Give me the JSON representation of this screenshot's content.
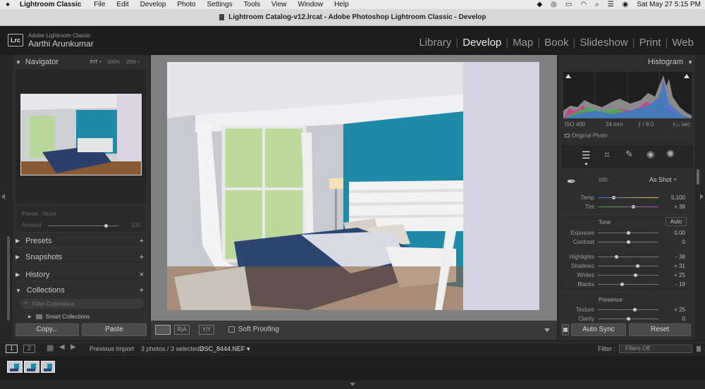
{
  "menubar": {
    "app": "Lightroom Classic",
    "items": [
      "File",
      "Edit",
      "Develop",
      "Photo",
      "Settings",
      "Tools",
      "View",
      "Window",
      "Help"
    ],
    "datetime": "Sat May 27  5:15 PM"
  },
  "window": {
    "title": "Lightroom Catalog-v12.lrcat - Adobe Photoshop Lightroom Classic - Develop"
  },
  "identity": {
    "logo": "Lrc",
    "product": "Adobe Lightroom Classic",
    "user": "Aarthi Arunkumar"
  },
  "modules": [
    "Library",
    "Develop",
    "Map",
    "Book",
    "Slideshow",
    "Print",
    "Web"
  ],
  "active_module": "Develop",
  "left": {
    "navigator": {
      "title": "Navigator",
      "zoom_fit": "FIT ÷",
      "zoom_100": "100%",
      "zoom_25": "25% ÷"
    },
    "preset": {
      "label": "Preset : None",
      "amount_label": "Amount",
      "amount_value": "100",
      "amount_fraction": 0.6
    },
    "sections": [
      {
        "name": "Presets",
        "action": "+"
      },
      {
        "name": "Snapshots",
        "action": "+"
      },
      {
        "name": "History",
        "action": "×"
      },
      {
        "name": "Collections",
        "action": "+"
      }
    ],
    "collections_filter_placeholder": "Filter Collections",
    "smart_collections": "Smart Collections",
    "copy_button": "Copy...",
    "paste_button": "Paste"
  },
  "toolbar": {
    "soft_proofing": "Soft Proofing",
    "compare_1": "R|A",
    "compare_2": "Y|Y"
  },
  "right": {
    "histogram": {
      "title": "Histogram",
      "iso": "ISO 400",
      "focal": "24 mm",
      "aperture": "ƒ / 8.0",
      "shutter": "¹⁄₂₅ sec",
      "original_photo": "Original Photo"
    },
    "wb": {
      "label": "WB :",
      "value": "As Shot ÷"
    },
    "sliders_wb": [
      {
        "label": "Temp",
        "value": "5,100",
        "pos": 0.25
      },
      {
        "label": "Tint",
        "value": "+ 38",
        "pos": 0.58
      }
    ],
    "tone": {
      "title": "Tone",
      "auto": "Auto"
    },
    "sliders_tone": [
      {
        "label": "Exposure",
        "value": "0.00",
        "pos": 0.5
      },
      {
        "label": "Contrast",
        "value": "0",
        "pos": 0.5
      }
    ],
    "sliders_tone2": [
      {
        "label": "Highlights",
        "value": "- 38",
        "pos": 0.3
      },
      {
        "label": "Shadows",
        "value": "+ 31",
        "pos": 0.65
      },
      {
        "label": "Whites",
        "value": "+ 25",
        "pos": 0.62
      },
      {
        "label": "Blacks",
        "value": "- 19",
        "pos": 0.4
      }
    ],
    "presence": {
      "title": "Presence"
    },
    "sliders_presence": [
      {
        "label": "Texture",
        "value": "+ 25",
        "pos": 0.6
      },
      {
        "label": "Clarity",
        "value": "0",
        "pos": 0.5
      }
    ],
    "auto_sync": "Auto Sync",
    "reset": "Reset"
  },
  "filmstrip": {
    "page1": "1",
    "page2": "2",
    "source": "Previous Import",
    "count": "3 photos / 3 selected /",
    "filename": "DSC_8444.NEF ▾",
    "filter_label": "Filter :",
    "filter_value": "Filters Off"
  },
  "colors": {
    "wall_teal": "#1e8aa8",
    "panel": "#2e2e2e",
    "background": "#262626"
  }
}
